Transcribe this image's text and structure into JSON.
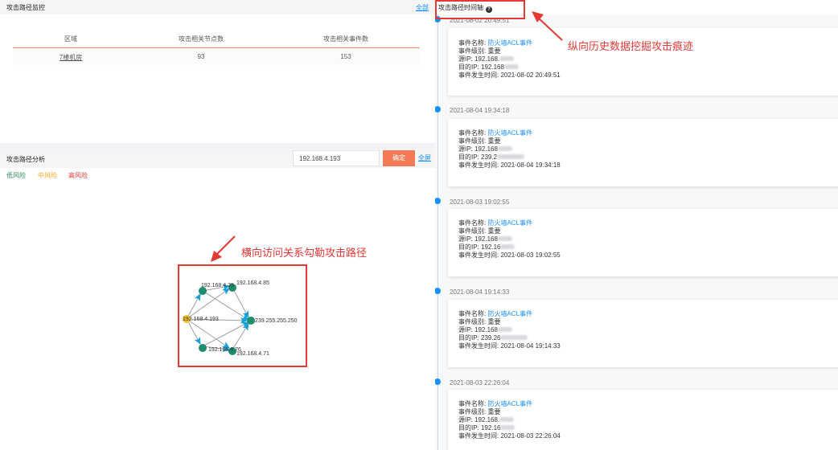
{
  "monitor": {
    "title": "攻击路径监控",
    "all_link": "全部",
    "columns": [
      "区域",
      "攻击相关节点数",
      "攻击相关事件数"
    ],
    "row": {
      "area": "7楼机房",
      "nodes": "93",
      "events": "153"
    }
  },
  "analysis": {
    "title": "攻击路径分析",
    "ip_value": "192.168.4.193",
    "confirm": "确定",
    "fullscreen": "全屏",
    "risk_legend": [
      {
        "label": "低风险",
        "color": "#2e8b57"
      },
      {
        "label": "中风险",
        "color": "#f5a623"
      },
      {
        "label": "高风险",
        "color": "#e53935"
      }
    ],
    "graph_labels": {
      "n1": "192.168.4.35",
      "n2": "192.168.4.85",
      "center": "192.168.4.193",
      "target": "239.255.255.250",
      "n4": "192.168.4.76",
      "n5": "192.168.4.71"
    },
    "colors": {
      "node": "#1e8c6e",
      "center": "#f2c12e",
      "arrow": "#1aa0d8",
      "edge": "#9e9e9e"
    }
  },
  "annotations": {
    "horizontal": "横向访问关系勾勒攻击路径",
    "vertical": "纵向历史数据挖掘攻击痕迹"
  },
  "timeline": {
    "title": "攻击路径时间轴",
    "help_icon": "question-circle-icon",
    "labels": {
      "name": "事件名称: ",
      "level": "事件级别: ",
      "src": "源IP: ",
      "dst": "目的IP: ",
      "time": "事件发生时间: "
    },
    "events": [
      {
        "ts": "2021-08-02 20:49:51",
        "name": "防火墙ACL事件",
        "level": "重要",
        "src": "192.168.",
        "dst": "192.168",
        "time": "2021-08-02 20:49:51"
      },
      {
        "ts": "2021-08-04 19:34:18",
        "name": "防火墙ACL事件",
        "level": "重要",
        "src": "192.168",
        "dst": "239.2",
        "time": "2021-08-04 19:34:18"
      },
      {
        "ts": "2021-08-03 19:02:55",
        "name": "防火墙ACL事件",
        "level": "重要",
        "src": "192.168",
        "dst": "192.16",
        "time": "2021-08-03 19:02:55"
      },
      {
        "ts": "2021-08-04 19:14:33",
        "name": "防火墙ACL事件",
        "level": "重要",
        "src": "192.168",
        "dst": "239.26",
        "time": "2021-08-04 19:14:33"
      },
      {
        "ts": "2021-08-03 22:26:04",
        "name": "防火墙ACL事件",
        "level": "重要",
        "src": "192.168.",
        "dst": "192.16",
        "time": "2021-08-03 22:26:04"
      }
    ]
  }
}
